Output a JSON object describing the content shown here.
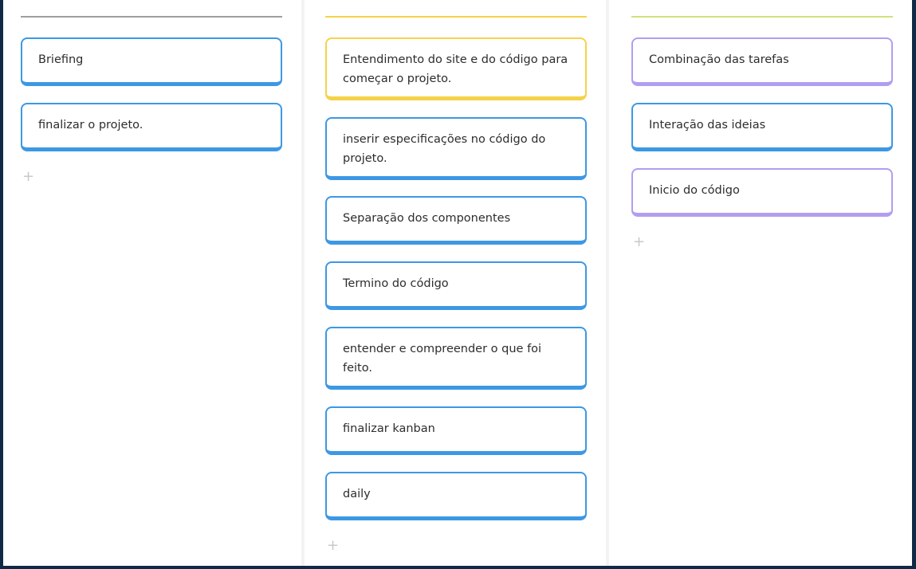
{
  "colors": {
    "frame": "#0f2a47",
    "column_1_line": "#9e9e9e",
    "column_2_line": "#f6d24b",
    "column_3_line": "#cfe27a",
    "card_blue": "#3d98e4",
    "card_yellow": "#f6d24b",
    "card_purple": "#b29ef0"
  },
  "columns": [
    {
      "cards": [
        {
          "text": "Briefing",
          "color": "blue"
        },
        {
          "text": "finalizar o projeto.",
          "color": "blue"
        }
      ],
      "add_icon": "+"
    },
    {
      "cards": [
        {
          "text": "Entendimento do site e do código para começar o projeto.",
          "color": "yellow"
        },
        {
          "text": "inserir especificações no código do projeto.",
          "color": "blue"
        },
        {
          "text": "Separação dos componentes",
          "color": "blue"
        },
        {
          "text": "Termino do código",
          "color": "blue"
        },
        {
          "text": "entender e compreender o que foi feito.",
          "color": "blue"
        },
        {
          "text": "finalizar kanban",
          "color": "blue"
        },
        {
          "text": "daily",
          "color": "blue"
        }
      ],
      "add_icon": "+"
    },
    {
      "cards": [
        {
          "text": "Combinação das tarefas",
          "color": "purple"
        },
        {
          "text": "Interação das ideias",
          "color": "blue"
        },
        {
          "text": "Inicio do código",
          "color": "purple"
        }
      ],
      "add_icon": "+"
    }
  ]
}
